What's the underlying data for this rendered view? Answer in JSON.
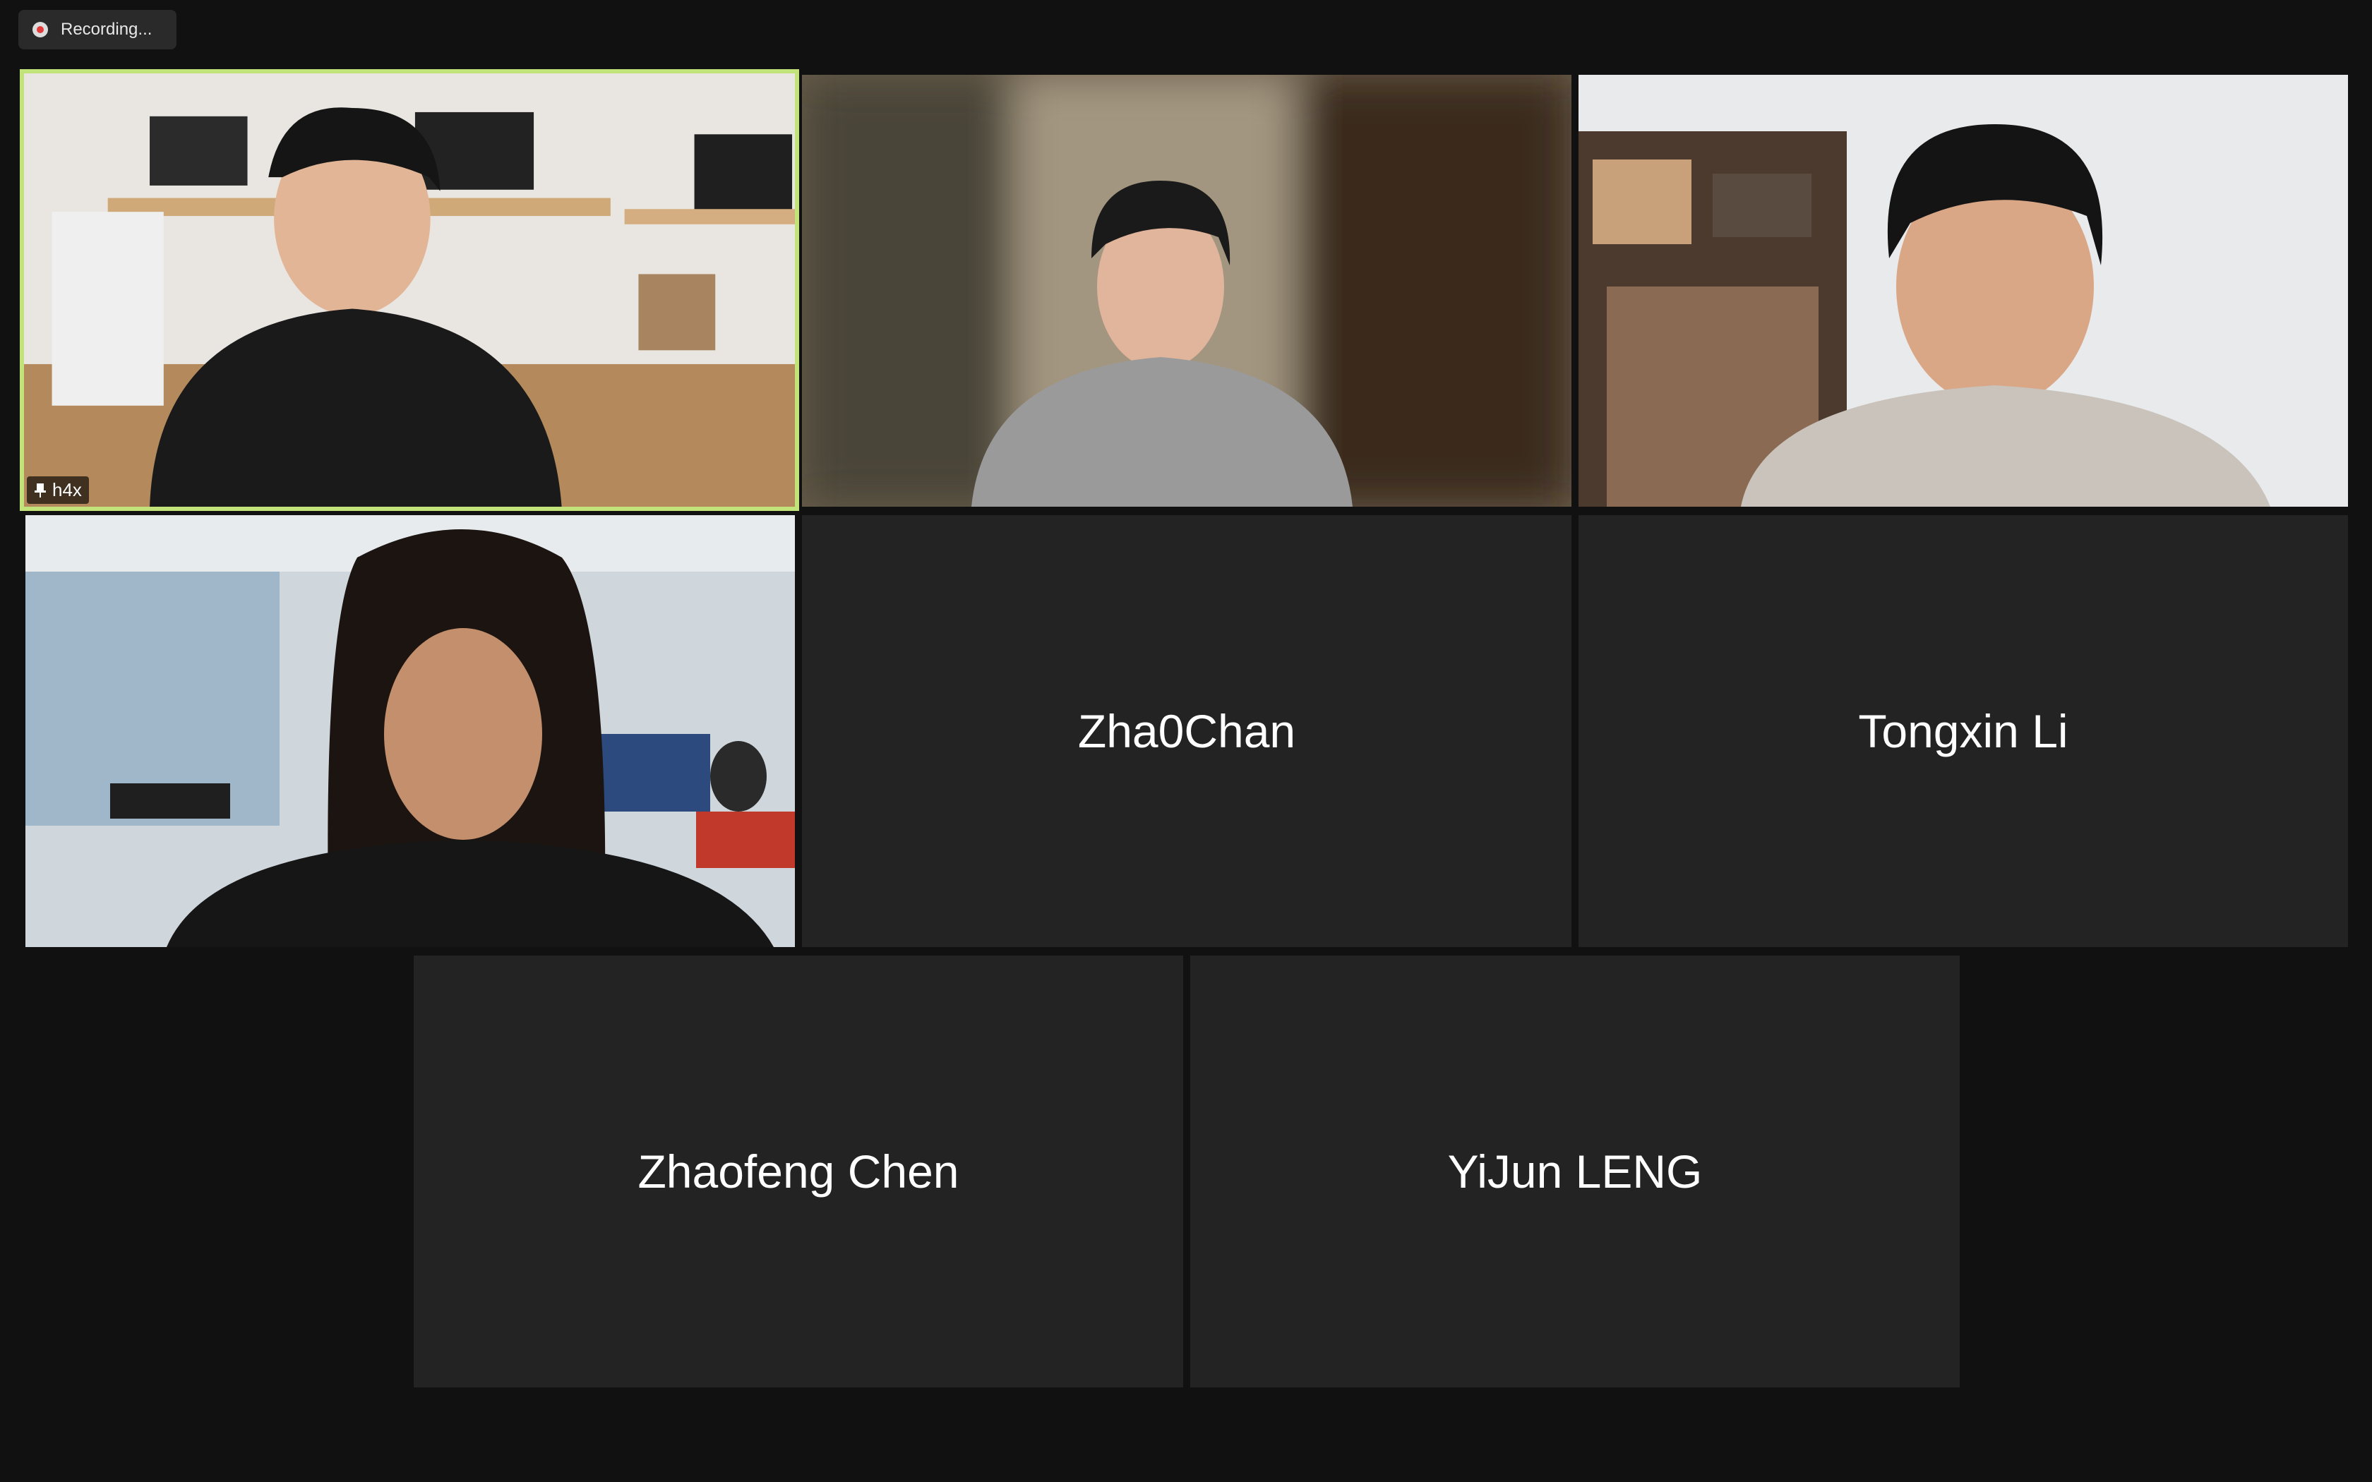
{
  "recording": {
    "label": "Recording..."
  },
  "participants": [
    {
      "name": "h4x",
      "video": true,
      "pinned": true,
      "active_speaker": true
    },
    {
      "name": "",
      "video": true
    },
    {
      "name": "",
      "video": true
    },
    {
      "name": "",
      "video": true
    },
    {
      "name": "Zha0Chan",
      "video": false
    },
    {
      "name": "Tongxin Li",
      "video": false
    },
    {
      "name": "Zhaofeng Chen",
      "video": false
    },
    {
      "name": "YiJun LENG",
      "video": false
    }
  ],
  "colors": {
    "background": "#111111",
    "tile": "#232323",
    "active_border": "#c2e27a"
  }
}
